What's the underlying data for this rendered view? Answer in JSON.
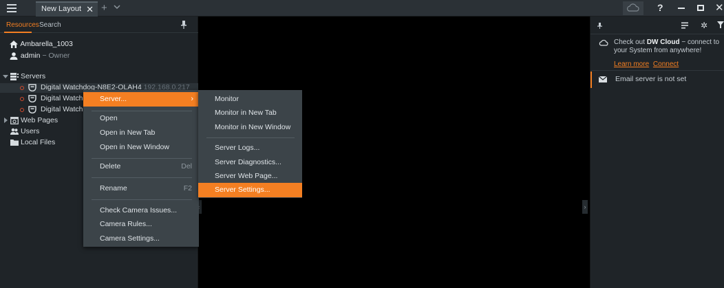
{
  "titlebar": {
    "tab_label": "New Layout",
    "tab_close": "✕",
    "new_tab": "+",
    "help": "?",
    "close": "✕"
  },
  "left_panel": {
    "tabs": [
      "Resources",
      "Search"
    ],
    "system_name": "Ambarella_1003",
    "user": "admin",
    "user_role": "− Owner",
    "tree": {
      "servers_label": "Servers",
      "server1_name": "Digital Watchdog-N8E2-OLAH4",
      "server1_ip": "192.168.0.217",
      "server2_name": "Digital Watch",
      "server3_name": "Digital Watch",
      "web_pages": "Web Pages",
      "users": "Users",
      "local_files": "Local Files"
    }
  },
  "context_menu": {
    "server": "Server...",
    "open": "Open",
    "open_new_tab": "Open in New Tab",
    "open_new_window": "Open in New Window",
    "delete": "Delete",
    "delete_shortcut": "Del",
    "rename": "Rename",
    "rename_shortcut": "F2",
    "check_camera_issues": "Check Camera Issues...",
    "camera_rules": "Camera Rules...",
    "camera_settings": "Camera Settings..."
  },
  "submenu": {
    "monitor": "Monitor",
    "monitor_new_tab": "Monitor in New Tab",
    "monitor_new_window": "Monitor in New Window",
    "server_logs": "Server Logs...",
    "server_diagnostics": "Server Diagnostics...",
    "server_web_page": "Server Web Page...",
    "server_settings": "Server Settings..."
  },
  "notifications": {
    "cloud_prefix": "Check out ",
    "cloud_brand": "DW Cloud",
    "cloud_suffix": " − connect to your System from anywhere!",
    "learn_more": "Learn more",
    "connect": "Connect",
    "email_not_set": "Email server is not set"
  },
  "colors": {
    "accent": "#f47f22",
    "panel": "#1f2428",
    "menu": "#3c4449",
    "status_offline": "#d34a2c"
  }
}
